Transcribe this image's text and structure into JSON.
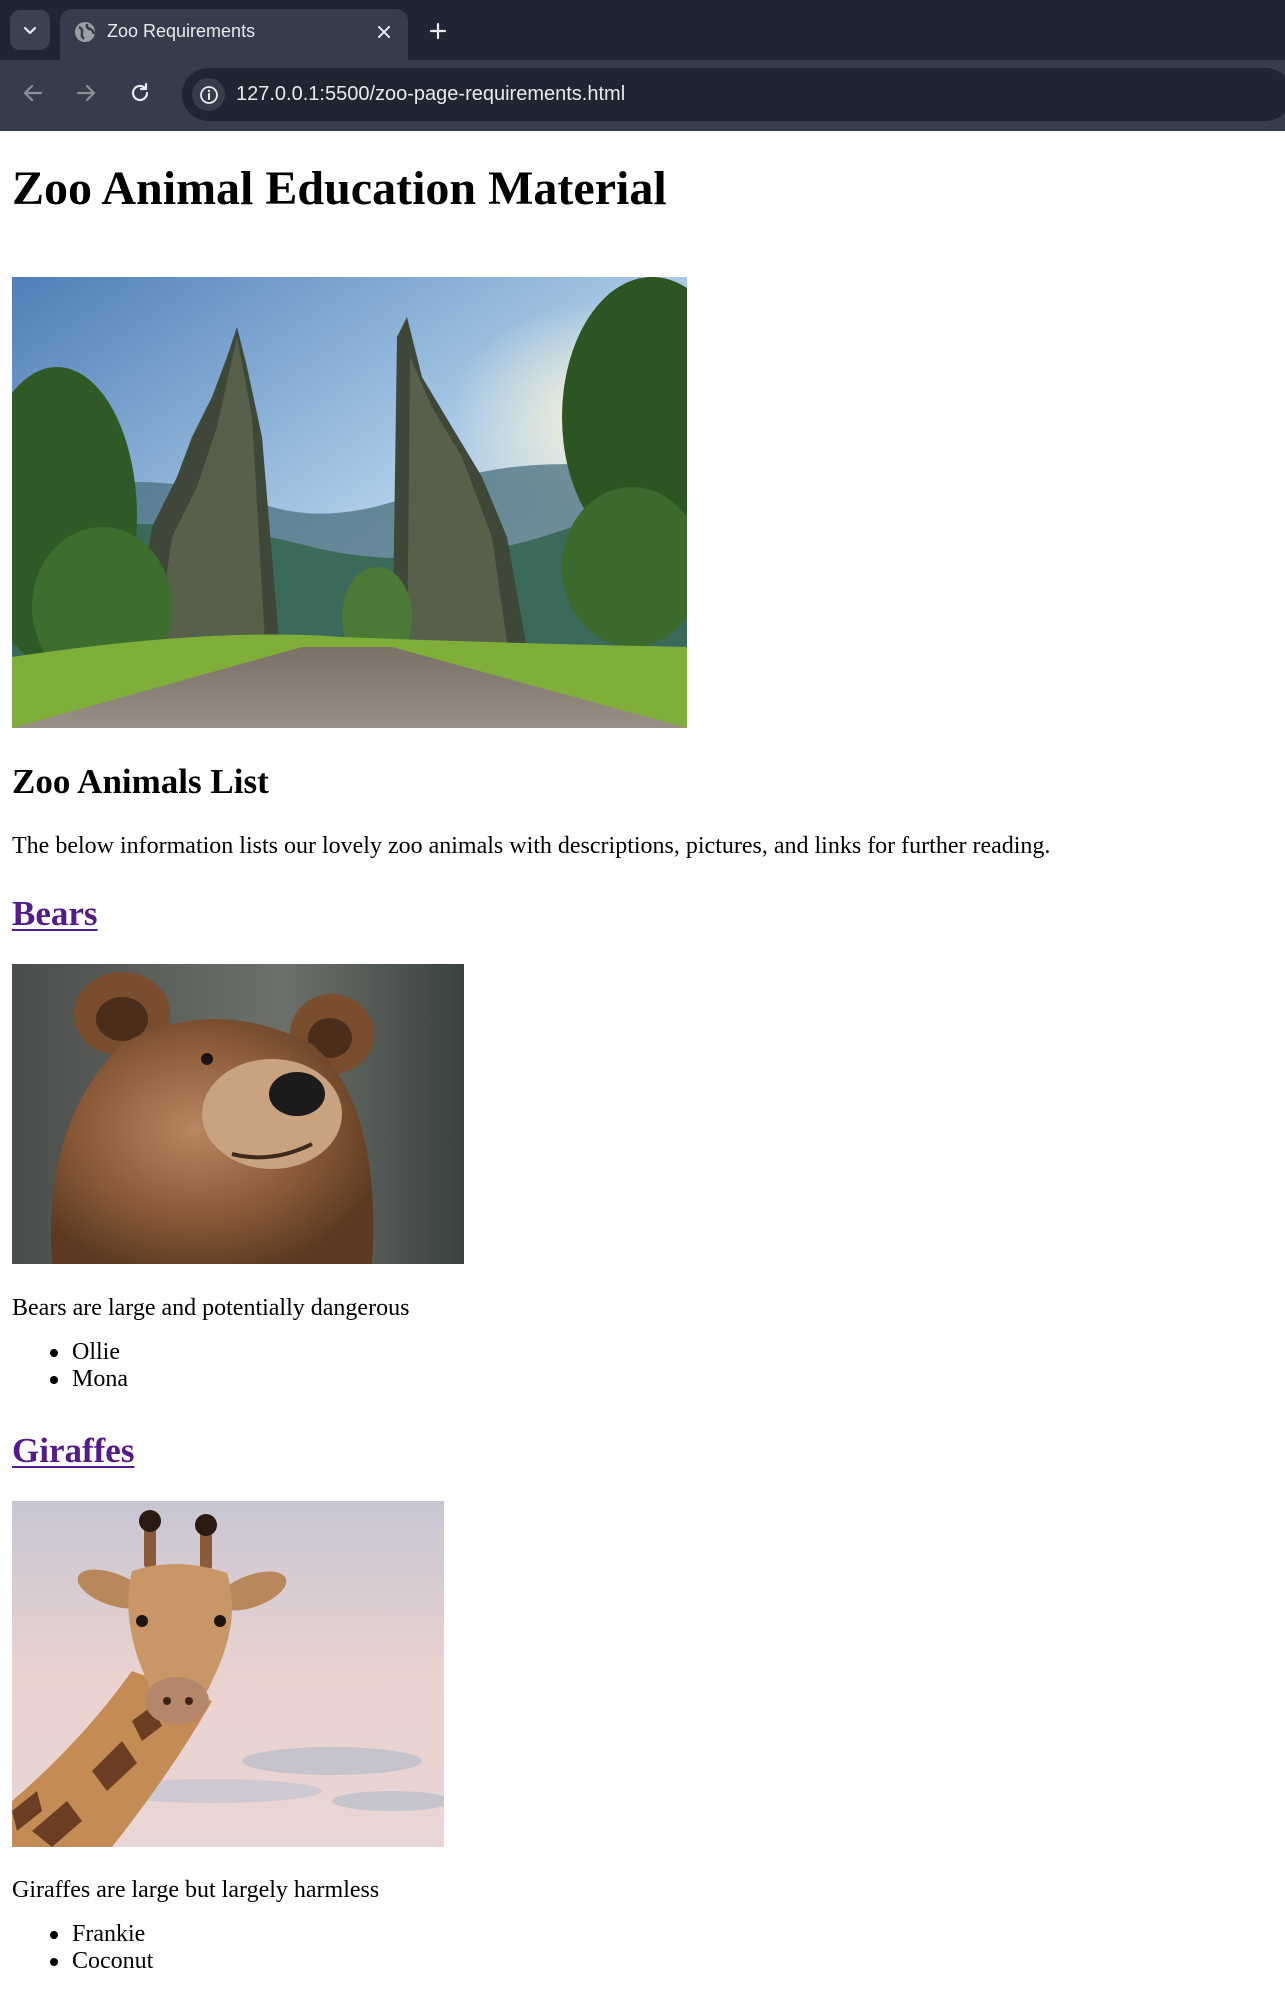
{
  "browser": {
    "tab_title": "Zoo Requirements",
    "url": "127.0.0.1:5500/zoo-page-requirements.html"
  },
  "page": {
    "title": "Zoo Animal Education Material",
    "list_heading": "Zoo Animals List",
    "intro": "The below information lists our lovely zoo animals with descriptions, pictures, and links for further reading.",
    "animals": [
      {
        "name": "Bears",
        "description": "Bears are large and potentially dangerous",
        "members": [
          "Ollie",
          "Mona"
        ]
      },
      {
        "name": "Giraffes",
        "description": "Giraffes are large but largely harmless",
        "members": [
          "Frankie",
          "Coconut"
        ]
      }
    ]
  },
  "colors": {
    "chrome_dark": "#1f2533",
    "chrome_tab": "#353c4b",
    "visited_link": "#551a8b"
  }
}
